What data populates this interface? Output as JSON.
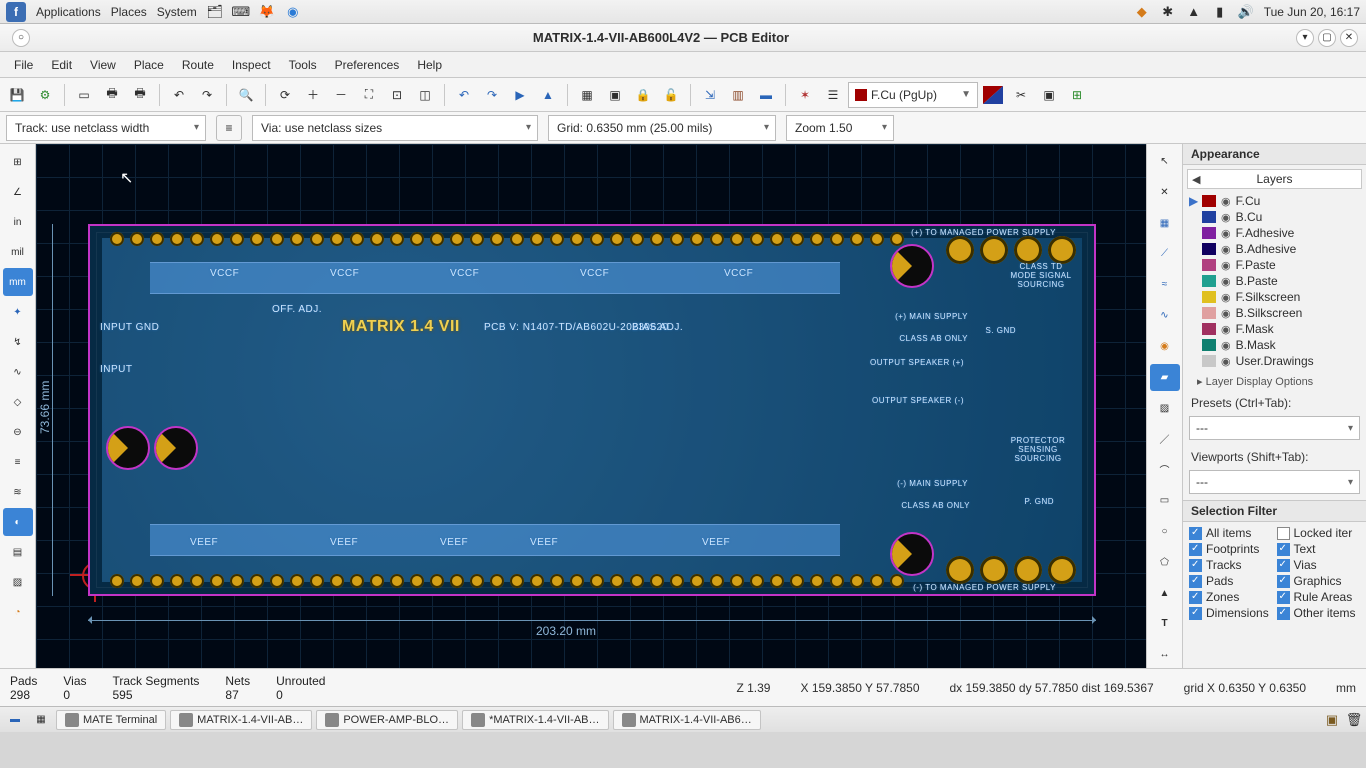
{
  "system_panel": {
    "menus": [
      "Applications",
      "Places",
      "System"
    ],
    "clock": "Tue Jun 20, 16:17"
  },
  "window": {
    "title": "MATRIX-1.4-VII-AB600L4V2 — PCB Editor"
  },
  "menubar": [
    "File",
    "Edit",
    "View",
    "Place",
    "Route",
    "Inspect",
    "Tools",
    "Preferences",
    "Help"
  ],
  "toolbar": {
    "layer_selected": "F.Cu (PgUp)"
  },
  "dropbar": {
    "track": "Track: use netclass width",
    "via": "Via: use netclass sizes",
    "grid": "Grid: 0.6350 mm (25.00 mils)",
    "zoom": "Zoom 1.50"
  },
  "left_tools": {
    "unit_in": "in",
    "unit_mil": "mil",
    "unit_mm": "mm"
  },
  "canvas": {
    "board_name": "MATRIX 1.4 VII",
    "pcb_version": "PCB V: N1407-TD/AB602U-20230620",
    "labels": {
      "vccf": "VCCF",
      "veef": "VEEF",
      "input_gnd": "INPUT GND",
      "input": "INPUT",
      "bias_adj": "BIAS ADJ.",
      "off_adj": "OFF. ADJ.",
      "to_managed_psu": "(+) TO MANAGED POWER SUPPLY",
      "to_managed_psu_neg": "(-) TO MANAGED POWER SUPPLY",
      "main_supply_plus": "(+) MAIN SUPPLY",
      "main_supply_minus": "(-) MAIN SUPPLY",
      "class_ab_only": "CLASS AB ONLY",
      "output_speaker_plus": "OUTPUT SPEAKER (+)",
      "output_speaker_minus": "OUTPUT SPEAKER (-)",
      "s_gnd": "S. GND",
      "p_gnd": "P. GND",
      "protector": "PROTECTOR SENSING SOURCING",
      "mode_signal": "CLASS TD MODE SIGNAL SOURCING"
    },
    "dim_w": "203.20  mm",
    "dim_h": "73.66  mm"
  },
  "appearance": {
    "title": "Appearance",
    "tab": "Layers",
    "layers": [
      {
        "name": "F.Cu",
        "color": "#a00000",
        "sel": true
      },
      {
        "name": "B.Cu",
        "color": "#2040a0"
      },
      {
        "name": "F.Adhesive",
        "color": "#8020a0"
      },
      {
        "name": "B.Adhesive",
        "color": "#100060"
      },
      {
        "name": "F.Paste",
        "color": "#b04080"
      },
      {
        "name": "B.Paste",
        "color": "#20a090"
      },
      {
        "name": "F.Silkscreen",
        "color": "#e0c020"
      },
      {
        "name": "B.Silkscreen",
        "color": "#e0a0a0"
      },
      {
        "name": "F.Mask",
        "color": "#a03060"
      },
      {
        "name": "B.Mask",
        "color": "#108070"
      },
      {
        "name": "User.Drawings",
        "color": "#c8c8c8"
      }
    ],
    "layer_display_options": "Layer Display Options",
    "presets_label": "Presets (Ctrl+Tab):",
    "presets_value": "---",
    "viewports_label": "Viewports (Shift+Tab):",
    "viewports_value": "---",
    "selection_filter": "Selection Filter",
    "filters": [
      {
        "label": "All items",
        "on": true
      },
      {
        "label": "Locked iter",
        "on": false
      },
      {
        "label": "Footprints",
        "on": true
      },
      {
        "label": "Text",
        "on": true
      },
      {
        "label": "Tracks",
        "on": true
      },
      {
        "label": "Vias",
        "on": true
      },
      {
        "label": "Pads",
        "on": true
      },
      {
        "label": "Graphics",
        "on": true
      },
      {
        "label": "Zones",
        "on": true
      },
      {
        "label": "Rule Areas",
        "on": true
      },
      {
        "label": "Dimensions",
        "on": true
      },
      {
        "label": "Other items",
        "on": true
      }
    ]
  },
  "status": {
    "pads_label": "Pads",
    "pads": "298",
    "vias_label": "Vias",
    "vias": "0",
    "ts_label": "Track Segments",
    "ts": "595",
    "nets_label": "Nets",
    "nets": "87",
    "unrouted_label": "Unrouted",
    "unrouted": "0",
    "z": "Z 1.39",
    "xy": "X 159.3850  Y 57.7850",
    "dxy": "dx 159.3850  dy 57.7850  dist 169.5367",
    "grid": "grid X 0.6350  Y 0.6350",
    "unit": "mm"
  },
  "taskbar": {
    "items": [
      "MATE Terminal",
      "MATRIX-1.4-VII-AB…",
      "POWER-AMP-BLO…",
      "*MATRIX-1.4-VII-AB…",
      "MATRIX-1.4-VII-AB6…"
    ]
  }
}
